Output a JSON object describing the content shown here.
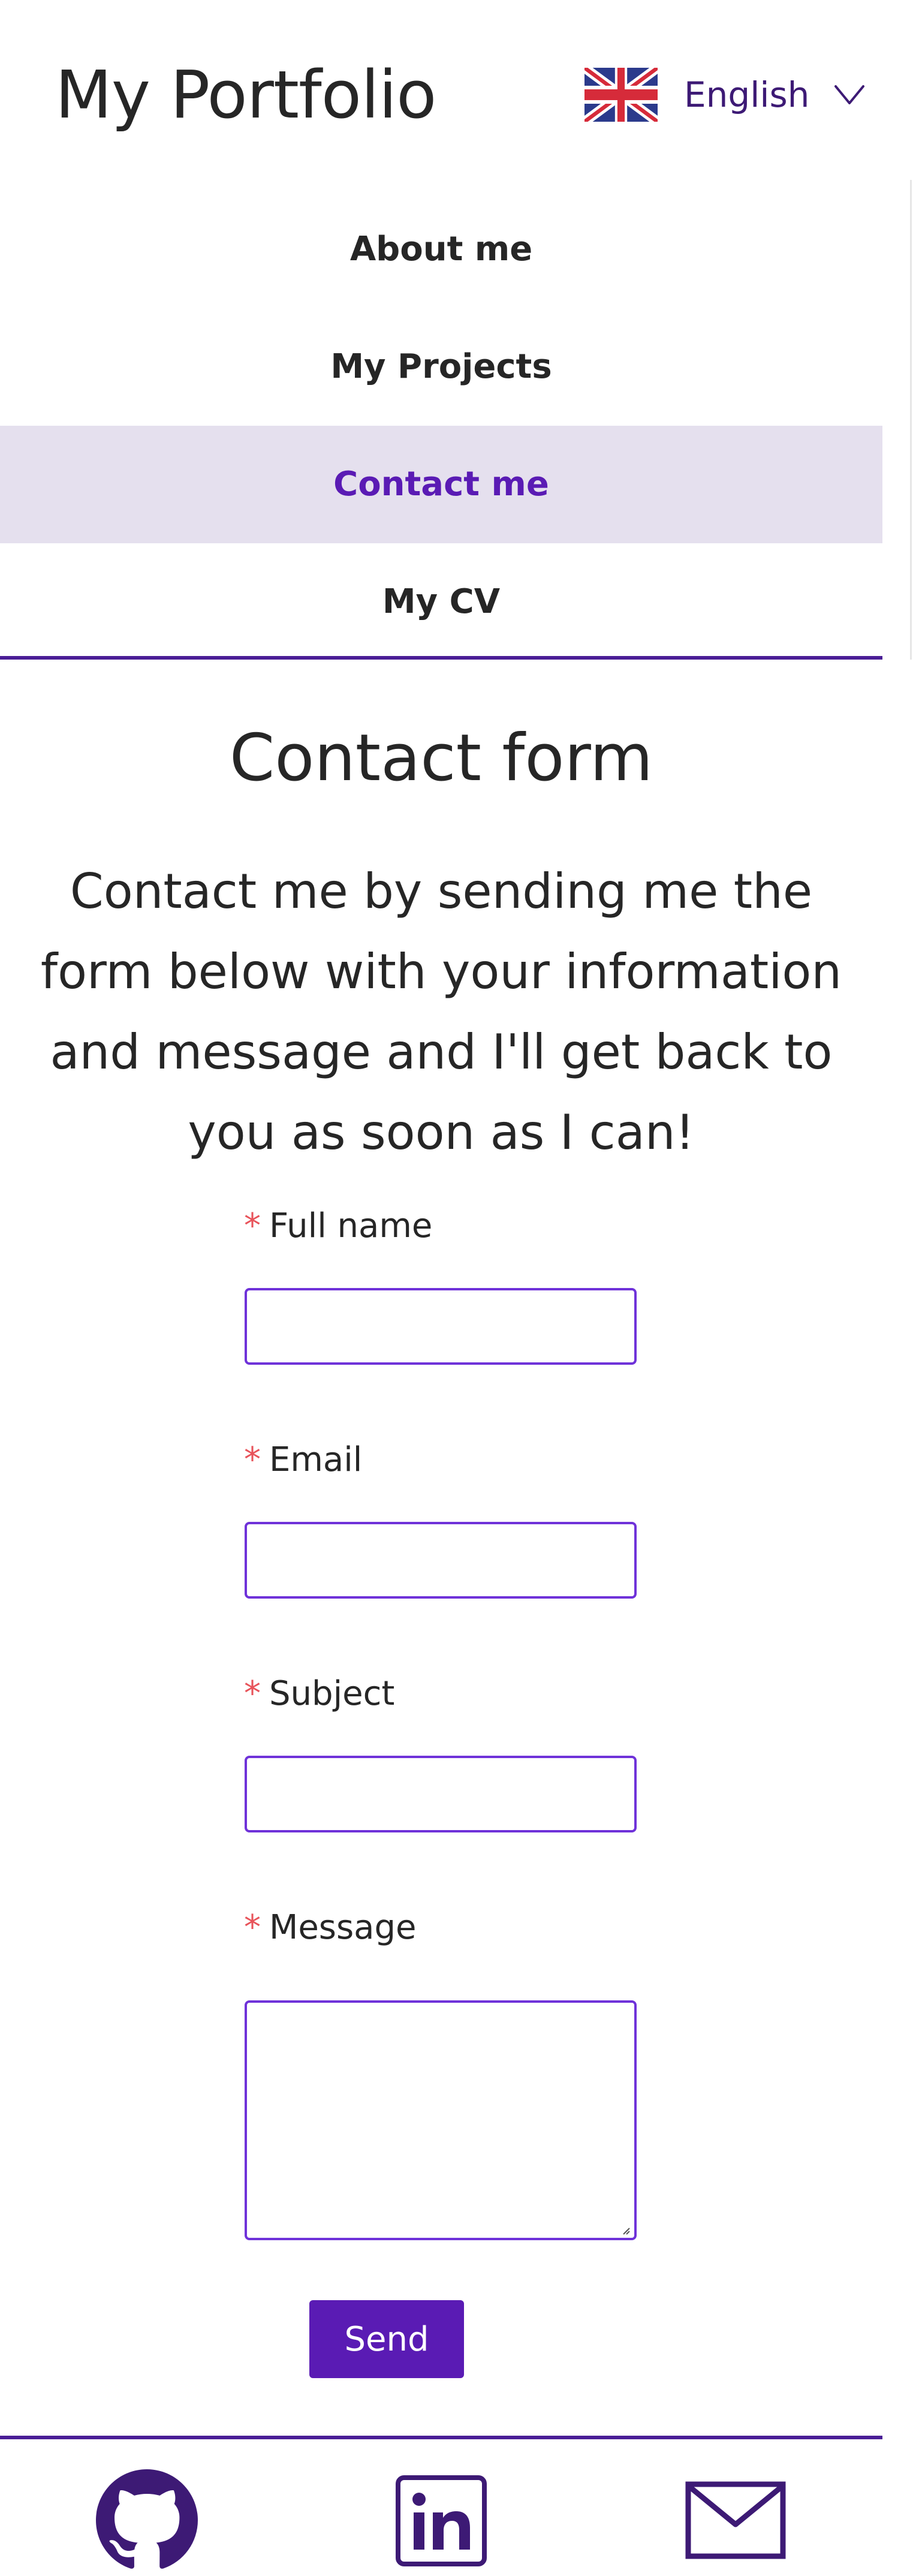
{
  "header": {
    "site_title": "My Portfolio",
    "language": {
      "label": "English",
      "flag_icon": "uk-flag-icon",
      "dropdown_icon": "chevron-down-icon"
    }
  },
  "nav": {
    "items": [
      {
        "label": "About me",
        "active": false
      },
      {
        "label": "My Projects",
        "active": false
      },
      {
        "label": "Contact me",
        "active": true
      },
      {
        "label": "My CV",
        "active": false
      }
    ]
  },
  "main": {
    "title": "Contact form",
    "intro": "Contact me by sending me the form below with your information and message and I'll get back to you as soon as I can!",
    "form": {
      "required_marker": "*",
      "fields": [
        {
          "label": "Full name",
          "value": ""
        },
        {
          "label": "Email",
          "value": ""
        },
        {
          "label": "Subject",
          "value": ""
        },
        {
          "label": "Message",
          "value": ""
        }
      ],
      "submit_label": "Send"
    }
  },
  "footer": {
    "links": [
      {
        "icon": "github-icon"
      },
      {
        "icon": "linkedin-icon"
      },
      {
        "icon": "mail-icon"
      }
    ]
  },
  "colors": {
    "accent": "#5a1bb4",
    "accent_dark": "#3d1a75",
    "active_nav_bg": "#e5e0ee",
    "input_border": "#6f32d9",
    "required": "#e8535a",
    "text": "#262626"
  }
}
